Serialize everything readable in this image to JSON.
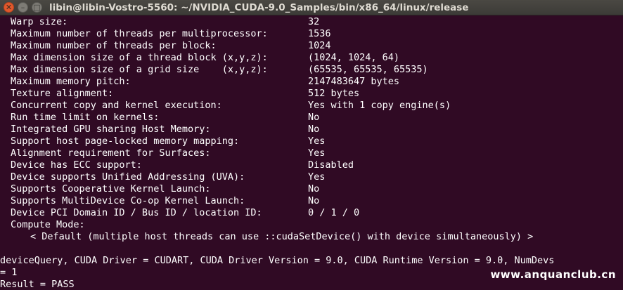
{
  "window": {
    "title": "libin@libin-Vostro-5560: ~/NVIDIA_CUDA-9.0_Samples/bin/x86_64/linux/release",
    "close_glyph": "✕",
    "minimize_glyph": "–",
    "maximize_glyph": "□"
  },
  "terminal": {
    "rows": [
      {
        "label": "Warp size:",
        "value": "32"
      },
      {
        "label": "Maximum number of threads per multiprocessor:",
        "value": "1536"
      },
      {
        "label": "Maximum number of threads per block:",
        "value": "1024"
      },
      {
        "label": "Max dimension size of a thread block (x,y,z):",
        "value": "(1024, 1024, 64)"
      },
      {
        "label": "Max dimension size of a grid size    (x,y,z):",
        "value": "(65535, 65535, 65535)"
      },
      {
        "label": "Maximum memory pitch:",
        "value": "2147483647 bytes"
      },
      {
        "label": "Texture alignment:",
        "value": "512 bytes"
      },
      {
        "label": "Concurrent copy and kernel execution:",
        "value": "Yes with 1 copy engine(s)"
      },
      {
        "label": "Run time limit on kernels:",
        "value": "No"
      },
      {
        "label": "Integrated GPU sharing Host Memory:",
        "value": "No"
      },
      {
        "label": "Support host page-locked memory mapping:",
        "value": "Yes"
      },
      {
        "label": "Alignment requirement for Surfaces:",
        "value": "Yes"
      },
      {
        "label": "Device has ECC support:",
        "value": "Disabled"
      },
      {
        "label": "Device supports Unified Addressing (UVA):",
        "value": "Yes"
      },
      {
        "label": "Supports Cooperative Kernel Launch:",
        "value": "No"
      },
      {
        "label": "Supports MultiDevice Co-op Kernel Launch:",
        "value": "No"
      },
      {
        "label": "Device PCI Domain ID / Bus ID / location ID:",
        "value": "0 / 1 / 0"
      }
    ],
    "compute_mode_label": "Compute Mode:",
    "compute_mode_value": "< Default (multiple host threads can use ::cudaSetDevice() with device simultaneously) >",
    "summary_line1": "deviceQuery, CUDA Driver = CUDART, CUDA Driver Version = 9.0, CUDA Runtime Version = 9.0, NumDevs",
    "summary_line2": "= 1",
    "result_line": "Result = PASS"
  },
  "watermark": "www.anquanclub.cn"
}
